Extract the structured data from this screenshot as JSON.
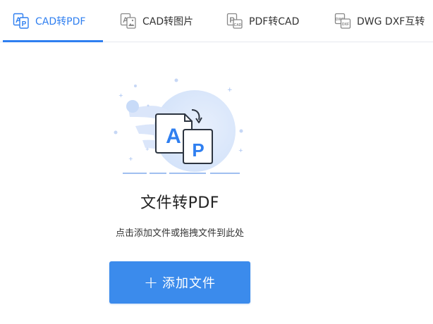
{
  "tabs": [
    {
      "label": "CAD转PDF",
      "icon": "ap-convert-icon",
      "active": true
    },
    {
      "label": "CAD转图片",
      "icon": "image-convert-icon",
      "active": false
    },
    {
      "label": "PDF转CAD",
      "icon": "pdf-cad-icon",
      "active": false
    },
    {
      "label": "DWG DXF互转",
      "icon": "dwg-dxf-icon",
      "active": false
    }
  ],
  "main": {
    "title": "文件转PDF",
    "hint": "点击添加文件或拖拽文件到此处",
    "add_button": {
      "plus": "+",
      "label": "添加文件"
    },
    "illustration": {
      "front_letter": "P",
      "back_letter": "A"
    }
  },
  "colors": {
    "accent": "#2f7ff0",
    "button": "#3b8bec",
    "illustration_blob": "#dbe8fb"
  }
}
